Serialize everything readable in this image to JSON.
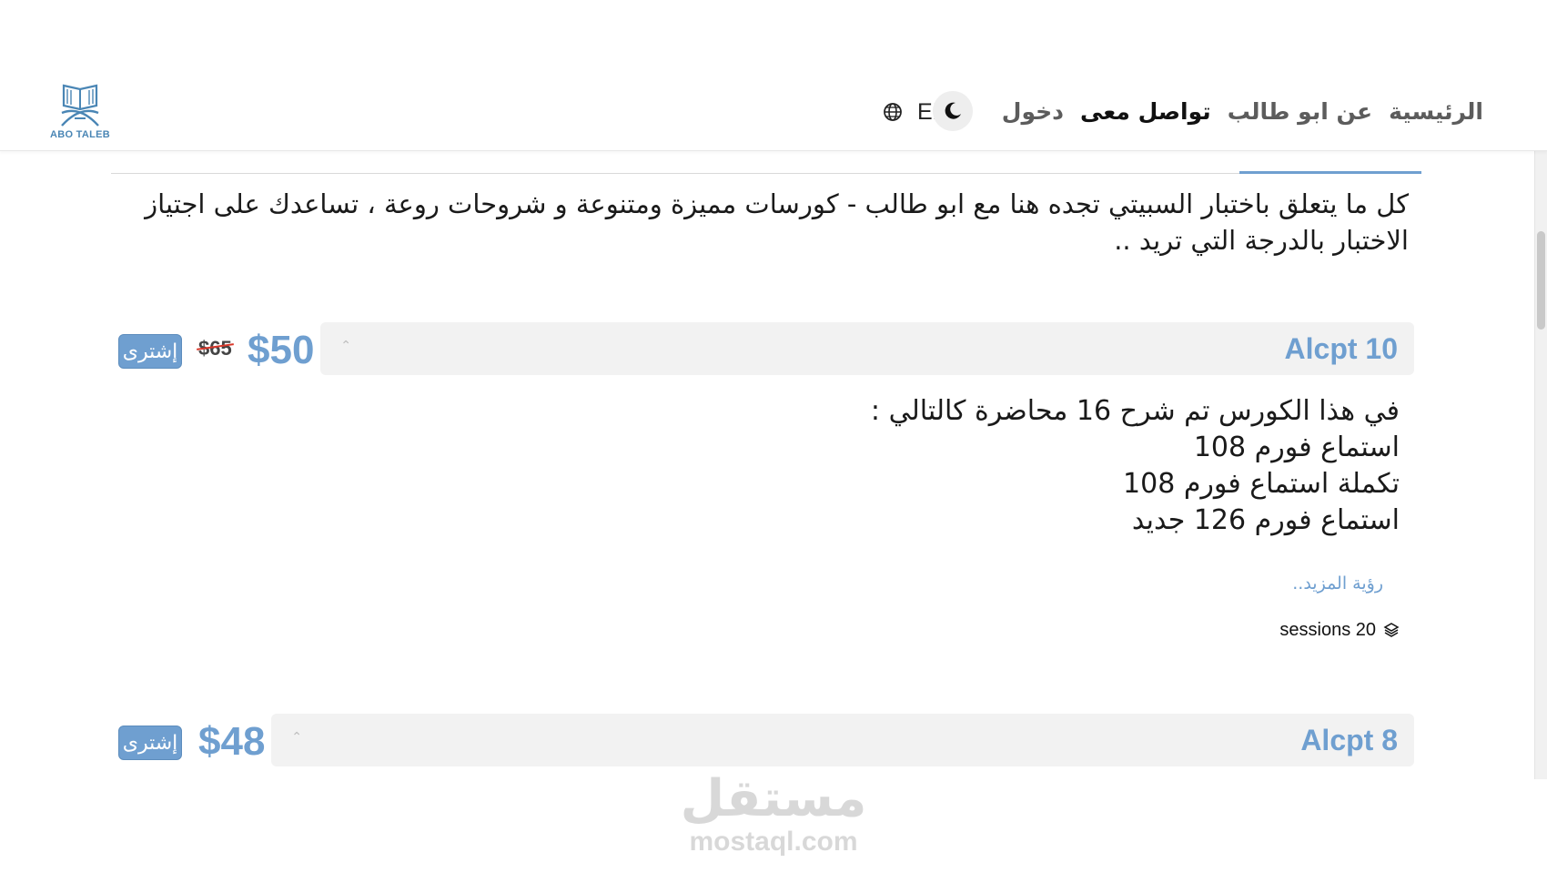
{
  "header": {
    "logo_text": "ABO TALEB",
    "nav": {
      "home": "الرئيسية",
      "about": "عن ابو طالب",
      "contact": "تواصل معى",
      "login": "دخول"
    },
    "theme_icon": "moon-icon",
    "language": "EN",
    "language_icon": "globe-icon"
  },
  "intro": {
    "text": "كل ما يتعلق باختبار السبيتي تجده هنا مع ابو طالب - كورسات مميزة ومتنوعة و شروحات روعة ، تساعدك على اجتياز الاختبار بالدرجة التي تريد .."
  },
  "courses": [
    {
      "title": "Alcpt 10",
      "price": "$50",
      "old_price": "$65",
      "buy_label": "إشترى",
      "description": [
        "في هذا الكورس تم شرح 16 محاضرة كالتالي :",
        "استماع فورم 108",
        "تكملة استماع فورم 108",
        "استماع فورم 126 جديد"
      ],
      "see_more": "رؤية المزيد..",
      "sessions": "sessions 20",
      "expanded": true
    },
    {
      "title": "Alcpt 8",
      "price": "$48",
      "buy_label": "إشترى",
      "expanded": false
    }
  ],
  "watermark": {
    "arabic": "مستقل",
    "latin": "mostaql.com"
  },
  "colors": {
    "accent": "#6f9fd0",
    "strike": "#d9372a",
    "bar_bg": "#f2f2f2"
  }
}
